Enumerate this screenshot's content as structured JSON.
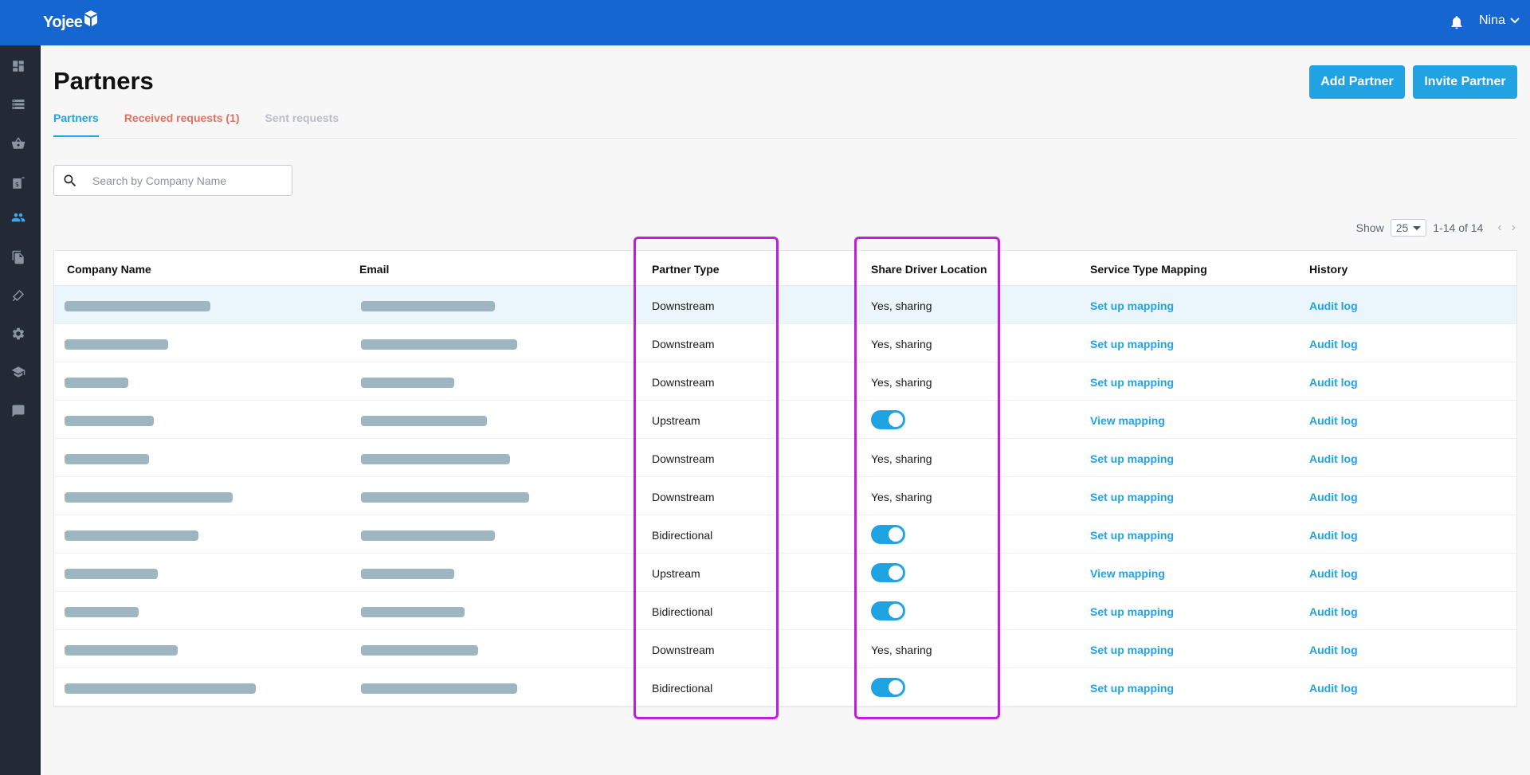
{
  "app": {
    "logo_text": "Yojee",
    "user_name": "Nina"
  },
  "sidebar": {
    "icons": [
      "dashboard-icon",
      "storage-icon",
      "basket-icon",
      "invoice-icon",
      "partners-icon",
      "documents-icon",
      "broadcast-icon",
      "settings-icon",
      "school-icon",
      "chat-icon"
    ]
  },
  "page": {
    "title": "Partners",
    "add_button": "Add Partner",
    "invite_button": "Invite Partner"
  },
  "tabs": {
    "partners": "Partners",
    "received": "Received requests (1)",
    "sent": "Sent requests"
  },
  "search": {
    "placeholder": "Search by Company Name"
  },
  "pager": {
    "show_label": "Show",
    "page_size": "25",
    "range": "1-14 of 14"
  },
  "table": {
    "headers": {
      "company": "Company Name",
      "email": "Email",
      "partner_type": "Partner Type",
      "share_location": "Share Driver Location",
      "service_mapping": "Service Type Mapping",
      "history": "History"
    },
    "rows": [
      {
        "partner_type": "Downstream",
        "share": "Yes, sharing",
        "toggle": false,
        "mapping": "Set up mapping",
        "history": "Audit log"
      },
      {
        "partner_type": "Downstream",
        "share": "Yes, sharing",
        "toggle": false,
        "mapping": "Set up mapping",
        "history": "Audit log"
      },
      {
        "partner_type": "Downstream",
        "share": "Yes, sharing",
        "toggle": false,
        "mapping": "Set up mapping",
        "history": "Audit log"
      },
      {
        "partner_type": "Upstream",
        "share": "",
        "toggle": true,
        "mapping": "View mapping",
        "history": "Audit log"
      },
      {
        "partner_type": "Downstream",
        "share": "Yes, sharing",
        "toggle": false,
        "mapping": "Set up mapping",
        "history": "Audit log"
      },
      {
        "partner_type": "Downstream",
        "share": "Yes, sharing",
        "toggle": false,
        "mapping": "Set up mapping",
        "history": "Audit log"
      },
      {
        "partner_type": "Bidirectional",
        "share": "",
        "toggle": true,
        "mapping": "Set up mapping",
        "history": "Audit log"
      },
      {
        "partner_type": "Upstream",
        "share": "",
        "toggle": true,
        "mapping": "View mapping",
        "history": "Audit log"
      },
      {
        "partner_type": "Bidirectional",
        "share": "",
        "toggle": true,
        "mapping": "Set up mapping",
        "history": "Audit log"
      },
      {
        "partner_type": "Downstream",
        "share": "Yes, sharing",
        "toggle": false,
        "mapping": "Set up mapping",
        "history": "Audit log"
      },
      {
        "partner_type": "Bidirectional",
        "share": "",
        "toggle": true,
        "mapping": "Set up mapping",
        "history": "Audit log"
      }
    ]
  },
  "colors": {
    "topbar": "#1566d0",
    "sidebar": "#232a35",
    "accent": "#21a3e3",
    "received_tab": "#e4705f",
    "highlight_box": "#c21ddf",
    "redacted": "#9fb5bf"
  }
}
